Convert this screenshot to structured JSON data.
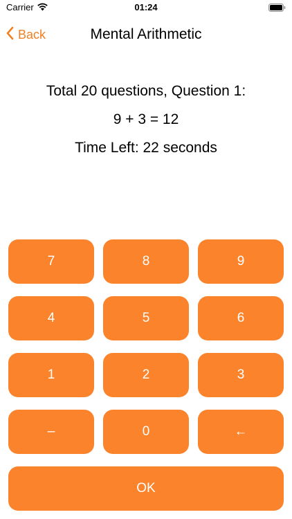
{
  "status_bar": {
    "carrier": "Carrier",
    "time": "01:24"
  },
  "nav": {
    "back_label": "Back",
    "title": "Mental Arithmetic"
  },
  "question": {
    "header": "Total 20 questions, Question 1:",
    "equation": "9 + 3 = 12",
    "timer": "Time Left: 22 seconds"
  },
  "keypad": {
    "rows": [
      [
        "7",
        "8",
        "9"
      ],
      [
        "4",
        "5",
        "6"
      ],
      [
        "1",
        "2",
        "3"
      ],
      [
        "–",
        "0",
        "←"
      ]
    ],
    "ok_label": "OK"
  },
  "colors": {
    "accent": "#fb832b",
    "back_link": "#f28023"
  }
}
